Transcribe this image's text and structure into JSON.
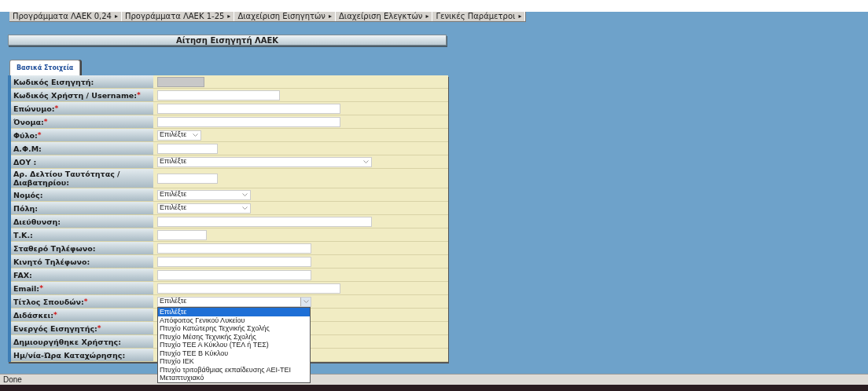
{
  "menu": [
    {
      "label": "Προγράμματα ΛΑΕΚ 0,24",
      "arrow": "▸"
    },
    {
      "label": "Προγράμματα ΛΑΕΚ 1-25",
      "arrow": "▸"
    },
    {
      "label": "Διαχείριση Εισηγητών",
      "arrow": "▸"
    },
    {
      "label": "Διαχείριση Ελεγκτών",
      "arrow": "▸"
    },
    {
      "label": "Γενικές Παράμετροι",
      "arrow": "▸"
    }
  ],
  "page_title": "Αίτηση Εισηγητή ΛΑΕΚ",
  "tabs": [
    {
      "label": "Βασικά Στοιχεία",
      "selected": true
    }
  ],
  "form": {
    "required_mark": "*",
    "rows": [
      {
        "label": "Κωδικός Εισηγητή:",
        "required": false,
        "field": {
          "kind": "readonly"
        }
      },
      {
        "label": "Κωδικός Χρήστη / Username:",
        "required": true,
        "field": {
          "kind": "text"
        }
      },
      {
        "label": "Επώνυμο:",
        "required": true,
        "field": {
          "kind": "text"
        }
      },
      {
        "label": "Όνομα:",
        "required": true,
        "field": {
          "kind": "text"
        }
      },
      {
        "label": "Φύλο:",
        "required": true,
        "field": {
          "kind": "select",
          "value": "Επιλέξτε"
        }
      },
      {
        "label": "Α.Φ.Μ:",
        "required": false,
        "field": {
          "kind": "text"
        }
      },
      {
        "label": "ΔΟΥ :",
        "required": false,
        "field": {
          "kind": "select",
          "value": "Επιλέξτε"
        }
      },
      {
        "label": "Αρ. Δελτίου Ταυτότητας / Διαβατηρίου:",
        "required": false,
        "field": {
          "kind": "text"
        }
      },
      {
        "label": "Νομός:",
        "required": false,
        "field": {
          "kind": "select",
          "value": "Επιλέξτε"
        }
      },
      {
        "label": "Πόλη:",
        "required": false,
        "field": {
          "kind": "select",
          "value": "Επιλέξτε"
        }
      },
      {
        "label": "Διεύθυνση:",
        "required": false,
        "field": {
          "kind": "text"
        }
      },
      {
        "label": "Τ.Κ.:",
        "required": false,
        "field": {
          "kind": "text"
        }
      },
      {
        "label": "Σταθερό Τηλέφωνο:",
        "required": false,
        "field": {
          "kind": "text"
        }
      },
      {
        "label": "Κινητό Τηλέφωνο:",
        "required": false,
        "field": {
          "kind": "text"
        }
      },
      {
        "label": "FAX:",
        "required": false,
        "field": {
          "kind": "text"
        }
      },
      {
        "label": "Email:",
        "required": true,
        "field": {
          "kind": "text"
        }
      },
      {
        "label": "Τίτλος Σπουδών:",
        "required": true,
        "field": {
          "kind": "select",
          "value": "Επιλέξτε",
          "expanded": true,
          "options": [
            {
              "label": "Επιλέξτε",
              "selected": true
            },
            {
              "label": "Απόφοιτος Γενικού Λυκείου",
              "selected": false
            },
            {
              "label": "Πτυχίο Κατώτερης Τεχνικής Σχολής",
              "selected": false
            },
            {
              "label": "Πτυχίο Μέσης Τεχνικής Σχολής",
              "selected": false
            },
            {
              "label": "Πτυχίο ΤΕΕ Α Κύκλου (ΤΕΛ ή ΤΕΣ)",
              "selected": false
            },
            {
              "label": "Πτυχίο ΤΕΕ Β Κύκλου",
              "selected": false
            },
            {
              "label": "Πτυχίο ΙΕΚ",
              "selected": false
            },
            {
              "label": "Πτυχίο τριτοβάθμιας εκπαίδευσης ΑΕΙ-ΤΕΙ",
              "selected": false
            },
            {
              "label": "Μεταπτυχιακό",
              "selected": false
            }
          ]
        }
      },
      {
        "label": "Διδάσκει:",
        "required": true
      },
      {
        "label": "Ενεργός Εισηγητής:",
        "required": true
      },
      {
        "label": "Δημιουργήθηκε Χρήστης:",
        "required": false
      },
      {
        "label": "Ημ/νία-Ώρα Καταχώρησης:",
        "required": false
      }
    ]
  },
  "status_bar": "Done"
}
